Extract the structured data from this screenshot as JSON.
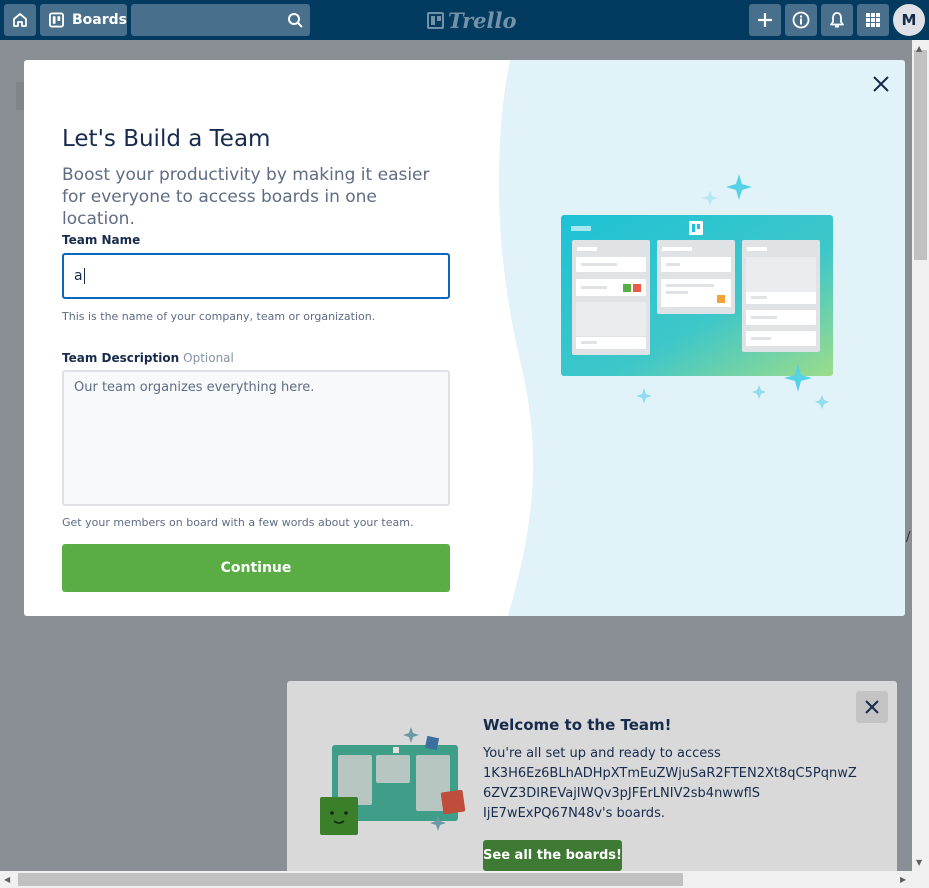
{
  "header": {
    "boards_label": "Boards",
    "logo_text": "Trello",
    "avatar_initial": "M",
    "icons": [
      "home-icon",
      "boards-icon",
      "search-icon",
      "plus-icon",
      "info-icon",
      "bell-icon",
      "apps-grid-icon"
    ]
  },
  "modal": {
    "title": "Let's Build a Team",
    "subtitle": "Boost your productivity by making it easier for everyone to access boards in one location.",
    "team_name_label": "Team Name",
    "team_name_value": "a",
    "team_name_help": "This is the name of your company, team or organization.",
    "team_description_label": "Team Description",
    "team_description_optional": "Optional",
    "team_description_placeholder": "Our team organizes everything here.",
    "team_description_help": "Get your members on board with a few words about your team.",
    "continue_label": "Continue"
  },
  "welcome": {
    "title": "Welcome to the Team!",
    "line1": "You're all set up and ready to access",
    "line2": "1K3H6Ez6BLhADHpXTmEuZWjuSaR2FTEN2Xt8qC5PqnwZ",
    "line3": "6ZVZ3DIREVajIWQv3pJFErLNIV2sb4nwwflS",
    "line4": "IjE7wExPQ67N48v's boards.",
    "button_label": "See all the boards!"
  },
  "colors": {
    "header_bg": "#023a60",
    "continue_green": "#5aac44",
    "input_focus_blue": "#0c66c0",
    "illustration_teal": "#1fc3d8"
  }
}
